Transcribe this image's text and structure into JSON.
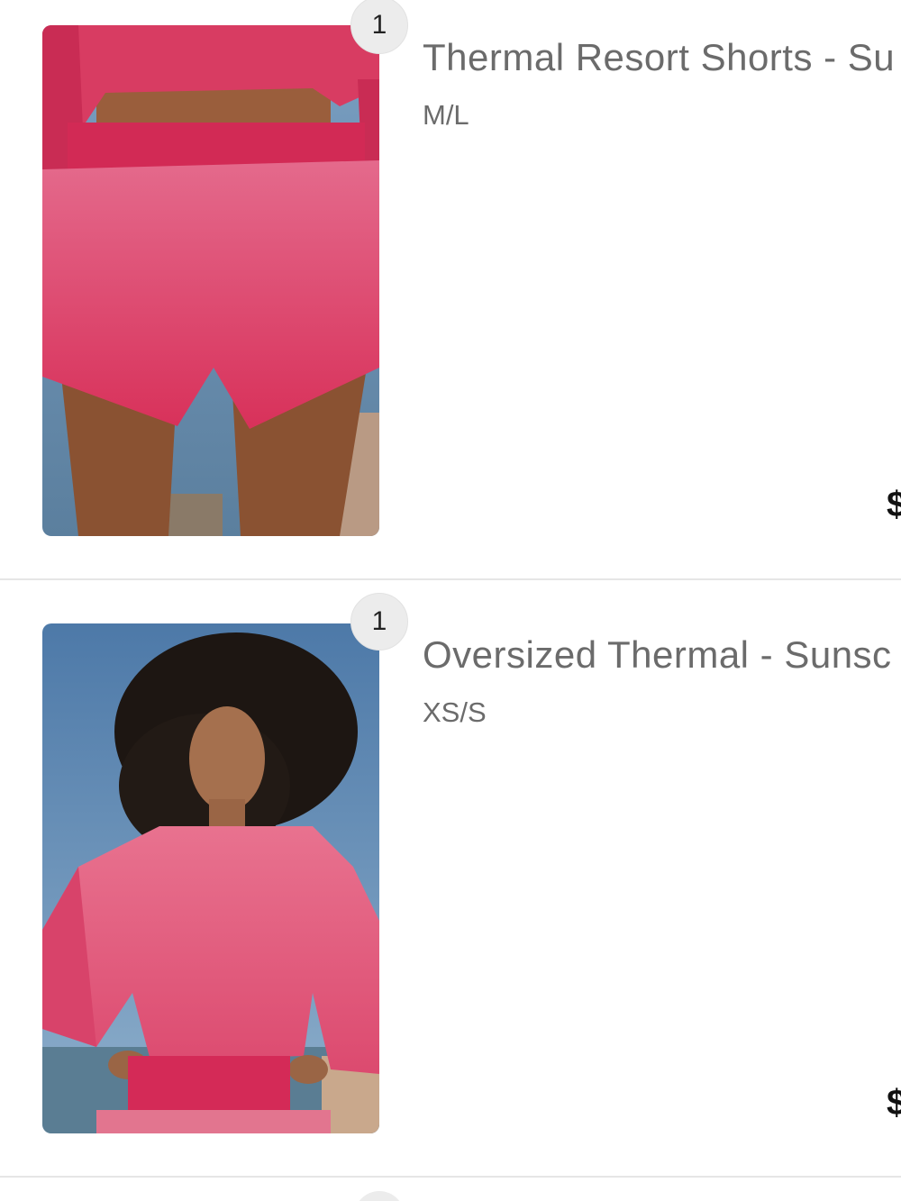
{
  "cart": {
    "items": [
      {
        "quantity": "1",
        "title": "Thermal Resort Shorts - Su",
        "variant": "M/L",
        "price": "$",
        "image": "pink-thermal-shorts-photo"
      },
      {
        "quantity": "1",
        "title": "Oversized Thermal - Sunsc",
        "variant": "XS/S",
        "price": "$",
        "image": "pink-oversized-sweatshirt-photo"
      }
    ]
  },
  "colors": {
    "badge_bg": "#ececec",
    "text_muted": "#6b6b6b",
    "product_pink": "#e8466e",
    "divider": "#e6e6e6"
  }
}
